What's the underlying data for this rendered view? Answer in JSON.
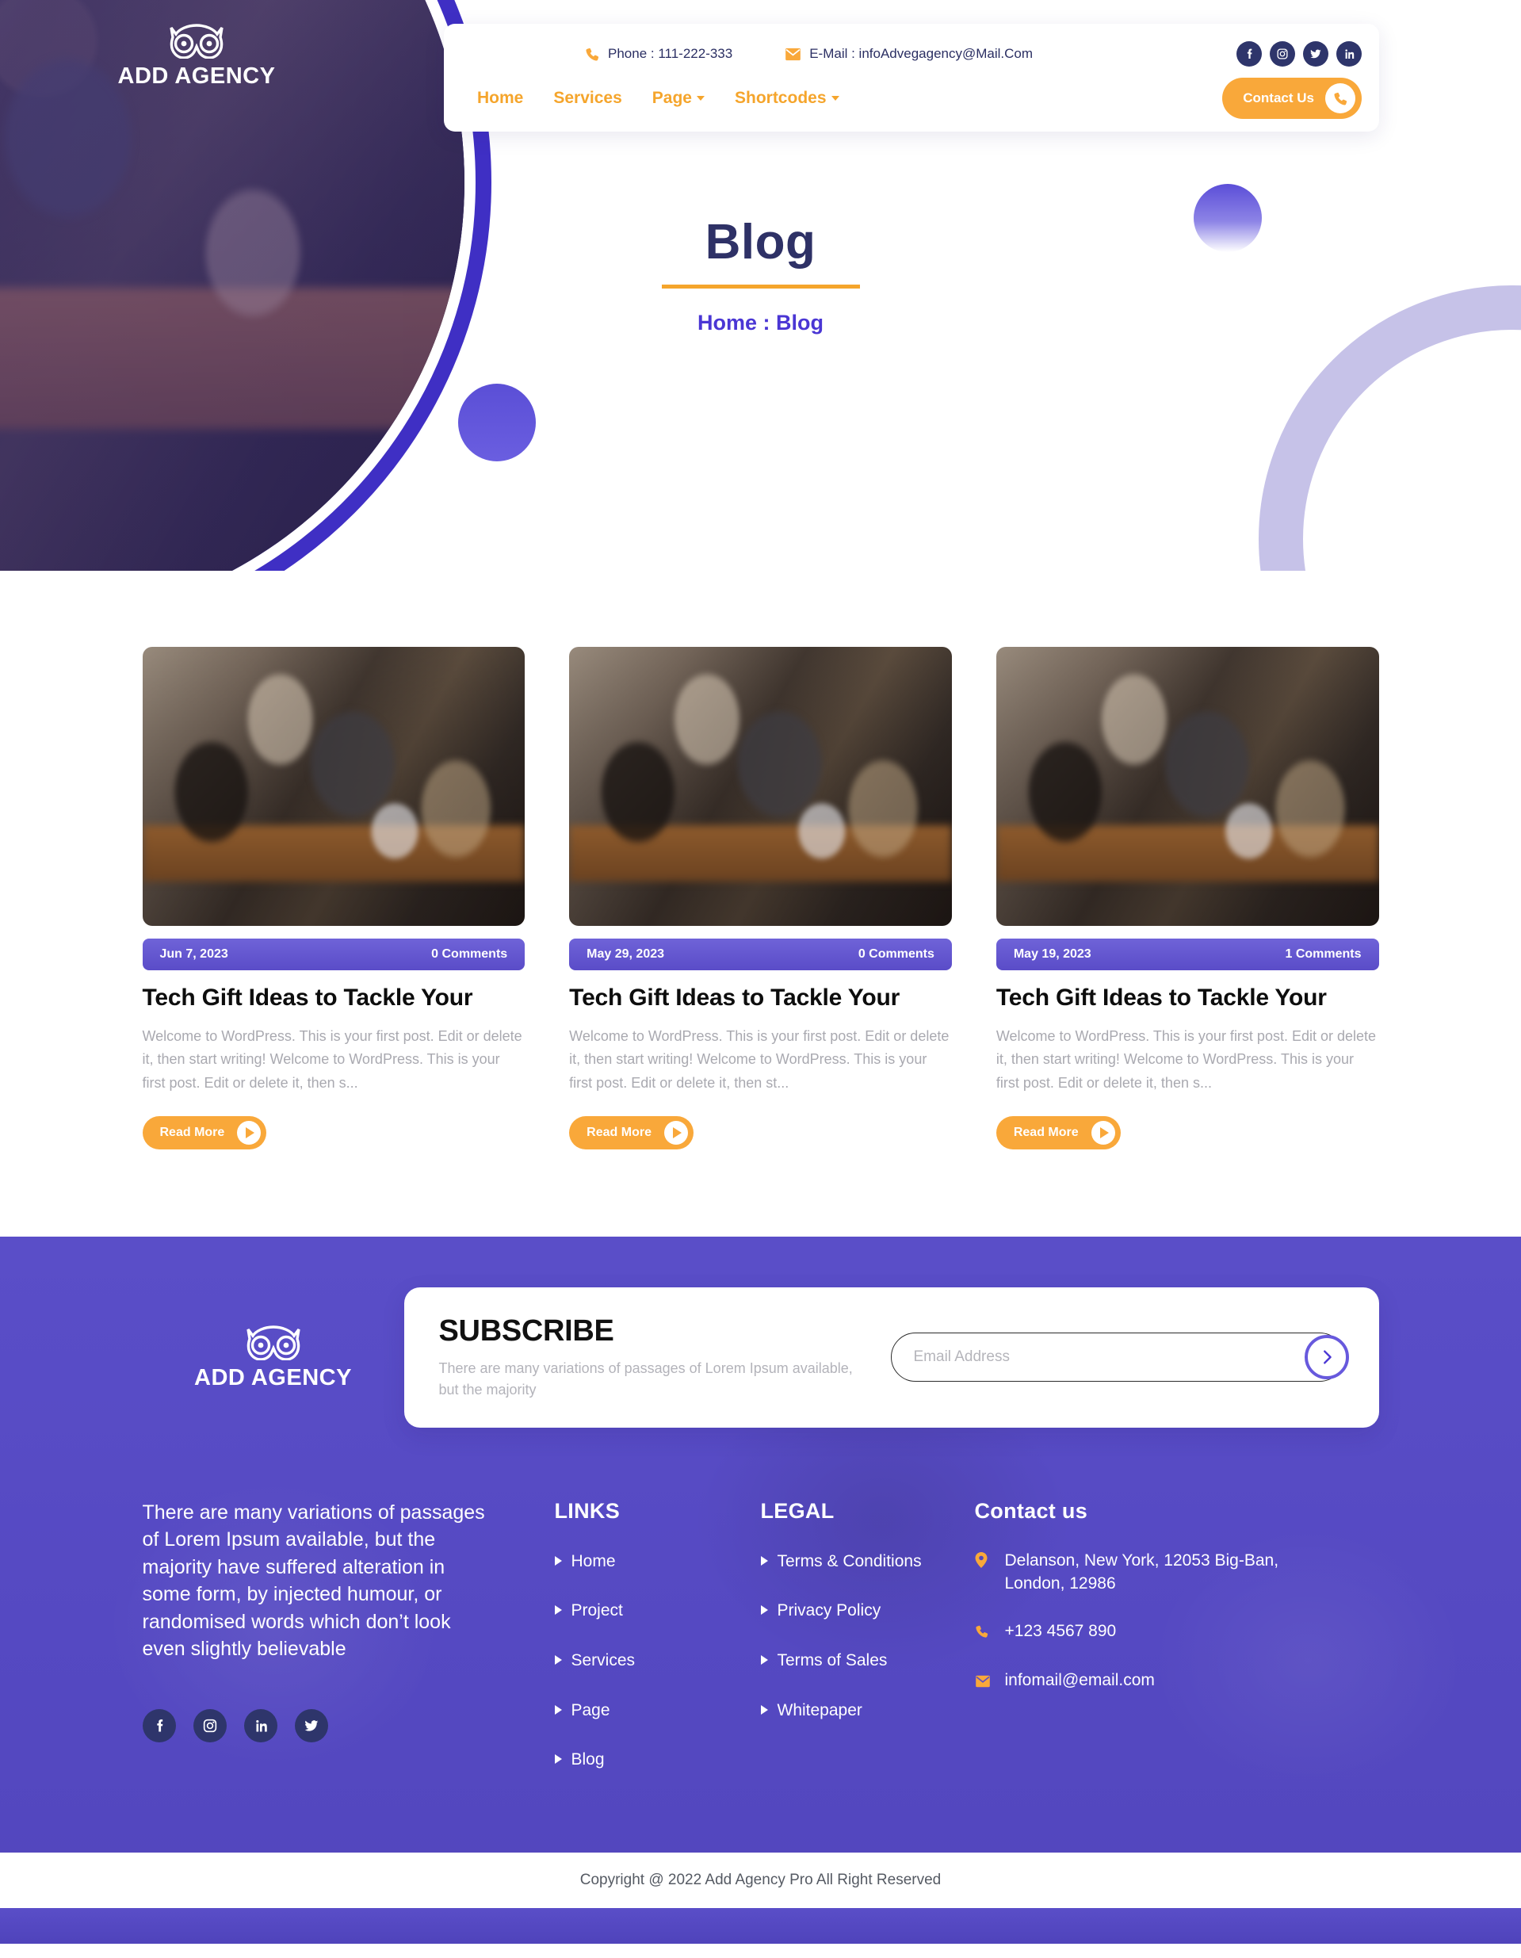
{
  "brand": {
    "name": "ADD AGENCY",
    "logo_icon": "owl-icon"
  },
  "topbar": {
    "phone_icon": "phone-icon",
    "phone": "Phone : 111-222-333",
    "email_icon": "envelope-icon",
    "email": "E-Mail : infoAdvegagency@Mail.Com",
    "socials": [
      {
        "name": "facebook-icon",
        "glyph": "f"
      },
      {
        "name": "instagram-icon",
        "glyph": "▣"
      },
      {
        "name": "twitter-icon",
        "glyph": "ᴠ"
      },
      {
        "name": "linkedin-icon",
        "glyph": "in"
      }
    ]
  },
  "nav": {
    "items": [
      {
        "label": "Home",
        "has_dropdown": false
      },
      {
        "label": "Services",
        "has_dropdown": false
      },
      {
        "label": "Page",
        "has_dropdown": true
      },
      {
        "label": "Shortcodes",
        "has_dropdown": true
      }
    ],
    "cta_label": "Contact Us",
    "cta_icon": "phone-icon"
  },
  "page": {
    "title": "Blog",
    "breadcrumb": "Home : Blog"
  },
  "posts": [
    {
      "date": "Jun 7, 2023",
      "comments": "0 Comments",
      "title": "Tech Gift Ideas to Tackle Your",
      "excerpt": "Welcome to WordPress. This is your first post. Edit or delete it, then start writing! Welcome to WordPress. This is your first post. Edit or delete it, then s...",
      "read_more": "Read More"
    },
    {
      "date": "May 29, 2023",
      "comments": "0 Comments",
      "title": "Tech Gift Ideas to Tackle Your",
      "excerpt": "Welcome to WordPress. This is your first post. Edit or delete it, then start writing! Welcome to WordPress. This is your first post. Edit or delete it, then st...",
      "read_more": "Read More"
    },
    {
      "date": "May 19, 2023",
      "comments": "1 Comments",
      "title": "Tech Gift Ideas to Tackle Your",
      "excerpt": "Welcome to WordPress. This is your first post. Edit or delete it, then start writing! Welcome to WordPress. This is your first post. Edit or delete it, then s...",
      "read_more": "Read More"
    }
  ],
  "subscribe": {
    "heading": "SUBSCRIBE",
    "text": "There are many variations of passages of Lorem Ipsum available, but the majority",
    "input_value": "",
    "placeholder": "Email Address",
    "submit_icon": "chevron-right-icon"
  },
  "footer": {
    "about": "There are many variations of passages of Lorem Ipsum available, but the majority have suffered alteration in some form, by injected humour, or randomised words which don’t look even slightly believable",
    "socials": [
      {
        "name": "facebook-icon",
        "glyph": "f"
      },
      {
        "name": "instagram-icon",
        "glyph": "▣"
      },
      {
        "name": "linkedin-icon",
        "glyph": "in"
      },
      {
        "name": "twitter-icon",
        "glyph": "ᴠ"
      }
    ],
    "links": {
      "heading": "LINKS",
      "items": [
        "Home",
        "Project",
        "Services",
        "Page",
        "Blog"
      ]
    },
    "legal": {
      "heading": "LEGAL",
      "items": [
        "Terms & Conditions",
        "Privacy Policy",
        "Terms of Sales",
        "Whitepaper"
      ]
    },
    "contact": {
      "heading": "Contact us",
      "address_icon": "location-pin-icon",
      "address": "Delanson, New York, 12053 Big-Ban, London, 12986",
      "phone_icon": "phone-icon",
      "phone": "+123 4567 890",
      "email_icon": "envelope-icon",
      "email": "infomail@email.com"
    },
    "copyright": "Copyright @ 2022 Add Agency Pro All Right Reserved"
  },
  "colors": {
    "accent_orange": "#f9a83a",
    "brand_purple": "#5a4ec8",
    "deep_purple": "#3f2fc4",
    "navy": "#2e3166",
    "social_navy": "#2e356b",
    "arc_light": "#c6c2e8"
  }
}
